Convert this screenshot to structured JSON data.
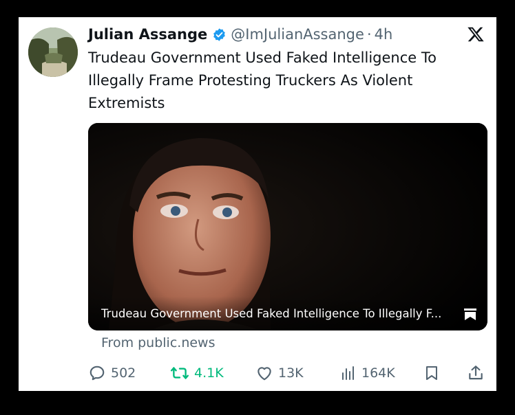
{
  "tweet": {
    "author_name": "Julian Assange",
    "handle": "@ImJulianAssange",
    "separator": "·",
    "time": "4h",
    "text": "Trudeau Government Used Faked Intelligence To Illegally Frame Protesting Truckers As Violent Extremists"
  },
  "media": {
    "caption": "Trudeau Government Used Faked Intelligence To Illegally F..."
  },
  "source": "From public.news",
  "stats": {
    "replies": "502",
    "retweets": "4.1K",
    "likes": "13K",
    "views": "164K"
  },
  "colors": {
    "verified": "#1d9bf0",
    "retweet": "#00ba7c",
    "muted": "#536471"
  },
  "icons": [
    "verified-badge-icon",
    "x-logo-icon",
    "reply-icon",
    "retweet-icon",
    "like-icon",
    "views-icon",
    "bookmark-icon",
    "share-icon"
  ]
}
